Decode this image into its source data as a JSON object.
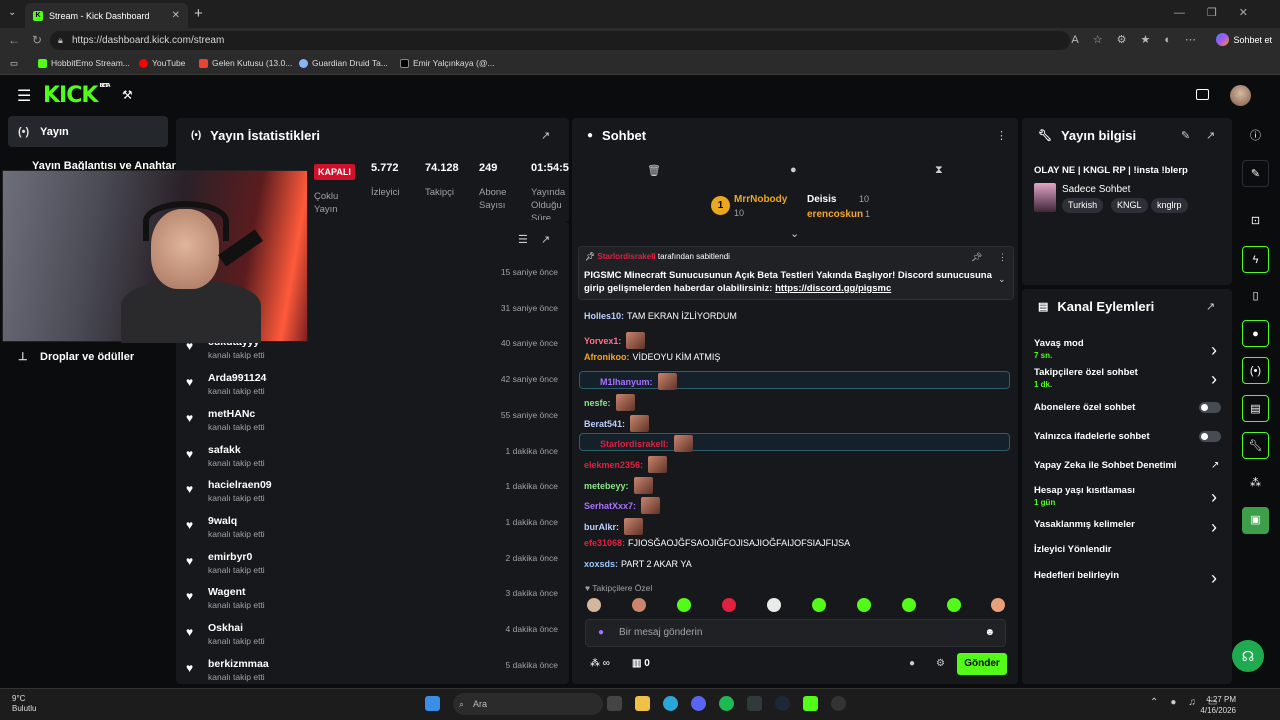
{
  "browser": {
    "tab_title": "Stream - Kick Dashboard",
    "url": "https://dashboard.kick.com/stream",
    "copilot_label": "Sohbet et",
    "bookmarks": [
      "HobbitEmo Stream...",
      "YouTube",
      "Gelen Kutusu (13.0...",
      "Guardian Druid Ta...",
      "Emir Yalçınkaya (@..."
    ]
  },
  "logo": {
    "text": "KICK",
    "badge": "BETA"
  },
  "leftnav": {
    "yayin": "Yayın",
    "baglanti": "Yayın Bağlantısı ve Anahtarı",
    "drop": "Droplar ve ödüller"
  },
  "stats": {
    "title": "Yayın İstatistikleri",
    "kapali": "KAPALI",
    "coklu": "Çoklu Yayın",
    "items": [
      {
        "value": "5.772",
        "label": "İzleyici"
      },
      {
        "value": "74.128",
        "label": "Takipçi"
      },
      {
        "value": "249",
        "label": "Abone Sayısı"
      },
      {
        "value": "01:54:56",
        "label": "Yayında Olduğu Süre"
      }
    ]
  },
  "followers": [
    {
      "name": "",
      "sub": "",
      "time": "15 saniye önce"
    },
    {
      "name": "",
      "sub": "",
      "time": "31 saniye önce"
    },
    {
      "name": "cukutayyy",
      "sub": "kanalı takip etti",
      "time": "40 saniye önce"
    },
    {
      "name": "Arda991124",
      "sub": "kanalı takip etti",
      "time": "42 saniye önce"
    },
    {
      "name": "metHANc",
      "sub": "kanalı takip etti",
      "time": "55 saniye önce"
    },
    {
      "name": "safakk",
      "sub": "kanalı takip etti",
      "time": "1 dakika önce"
    },
    {
      "name": "hacielraen09",
      "sub": "kanalı takip etti",
      "time": "1 dakika önce"
    },
    {
      "name": "9walq",
      "sub": "kanalı takip etti",
      "time": "1 dakika önce"
    },
    {
      "name": "emirbyr0",
      "sub": "kanalı takip etti",
      "time": "2 dakika önce"
    },
    {
      "name": "Wagent",
      "sub": "kanalı takip etti",
      "time": "3 dakika önce"
    },
    {
      "name": "Oskhai",
      "sub": "kanalı takip etti",
      "time": "4 dakika önce"
    },
    {
      "name": "berkizmmaa",
      "sub": "kanalı takip etti",
      "time": "5 dakika önce"
    }
  ],
  "chat": {
    "title": "Sohbet",
    "leaders": [
      {
        "name": "MrrNobody",
        "count": "10",
        "rank": "1"
      },
      {
        "name": "Deisis",
        "count": "10"
      },
      {
        "name": "erencoskun",
        "count": "1"
      }
    ],
    "pinned": {
      "by": "Starlordisrakell",
      "by_suffix": "tarafından sabitlendi",
      "text": "PIGSMC Minecraft Sunucusunun Açık Beta Testleri Yakında Başlıyor! Discord sunucusuna girip gelişmelerden haberdar olabilirsiniz:",
      "link": "https://discord.gg/pigsmc"
    },
    "messages": [
      {
        "user": "Holles10:",
        "text": "TAM EKRAN İZLİYORDUM",
        "color": "#bcd0ff"
      },
      {
        "user": "Yorvex1:",
        "text": "",
        "color": "#ff6f91",
        "emote": true
      },
      {
        "user": "Afronikoo:",
        "text": "VİDEOYU KİM ATMIŞ",
        "color": "#f5a623"
      },
      {
        "user": "M1lhanyum:",
        "text": "",
        "color": "#a970ff",
        "emote": true,
        "hl": true
      },
      {
        "user": "nesfe:",
        "text": "",
        "color": "#8be28b",
        "emote": true
      },
      {
        "user": "Berat541:",
        "text": "",
        "color": "#bcd0ff",
        "emote": true
      },
      {
        "user": "Starlordisrakell:",
        "text": "",
        "color": "#e0213f",
        "emote": true,
        "hl": true
      },
      {
        "user": "elekmen2356:",
        "text": "",
        "color": "#e0213f",
        "emote": true
      },
      {
        "user": "metebeyy:",
        "text": "",
        "color": "#8be28b",
        "emote": true
      },
      {
        "user": "SerhatXxx7:",
        "text": "",
        "color": "#a970ff",
        "emote": true
      },
      {
        "user": "burAlkr:",
        "text": "",
        "color": "#bcd0ff",
        "emote": true
      },
      {
        "user": "efe31068:",
        "text": "FJIOSĞAOJĞFSAOJIĞFOJISAJIOĞFAIJOFSIAJFIJSA",
        "color": "#e0213f"
      },
      {
        "user": "xoxsds:",
        "text": "PART 2 AKAR YA",
        "color": "#9ec5ff"
      }
    ],
    "followers_only": "Takipçilere Özel",
    "input_placeholder": "Bir mesaj gönderin",
    "points": "0",
    "send": "Gönder"
  },
  "info": {
    "title": "Yayın bilgisi",
    "stream_title": "OLAY NE | KNGL RP | !insta !blerp",
    "category": "Sadece Sohbet",
    "tags": [
      "Turkish",
      "KNGL",
      "knglrp"
    ]
  },
  "actions": {
    "title": "Kanal Eylemleri",
    "items": [
      {
        "label": "Yavaş mod",
        "sub": "7 sn.",
        "ctl": "chevron"
      },
      {
        "label": "Takipçilere özel sohbet",
        "sub": "1 dk.",
        "ctl": "chevron"
      },
      {
        "label": "Abonelere özel sohbet",
        "sub": "",
        "ctl": "toggle"
      },
      {
        "label": "Yalnızca ifadelerle sohbet",
        "sub": "",
        "ctl": "toggle"
      },
      {
        "label": "Yapay Zeka ile Sohbet Denetimi",
        "sub": "",
        "ctl": "external"
      },
      {
        "label": "Hesap yaşı kısıtlaması",
        "sub": "1 gün",
        "ctl": "chevron"
      },
      {
        "label": "Yasaklanmış kelimeler",
        "sub": "",
        "ctl": "chevron"
      },
      {
        "label": "İzleyici Yönlendir",
        "sub": "",
        "ctl": "none"
      },
      {
        "label": "Hedefleri belirleyin",
        "sub": "",
        "ctl": "chevron"
      }
    ]
  },
  "taskbar": {
    "temp": "9°C",
    "weather": "Bulutlu",
    "search": "Ara",
    "time": "4:27 PM",
    "date": "4/16/2026"
  },
  "colors": {
    "accent": "#53fc18",
    "live_red": "#d0112b",
    "panel": "#17181b"
  }
}
